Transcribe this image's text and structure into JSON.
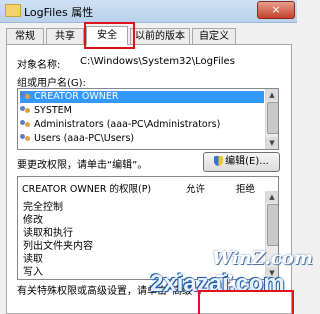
{
  "window": {
    "title": "LogFiles 属性",
    "close_label": "×"
  },
  "tabs": [
    "常规",
    "共享",
    "安全",
    "以前的版本",
    "自定义"
  ],
  "object_name": {
    "label": "对象名称:",
    "value": "C:\\Windows\\System32\\LogFiles"
  },
  "groups": {
    "label": "组或用户名(G):",
    "items": [
      "CREATOR OWNER",
      "SYSTEM",
      "Administrators (aaa-PC\\Administrators)",
      "Users (aaa-PC\\Users)"
    ]
  },
  "change_permissions": {
    "text": "要更改权限，请单击“编辑”。",
    "edit_button": "编辑(E)..."
  },
  "permissions": {
    "header": "CREATOR OWNER 的权限(P)",
    "allow": "允许",
    "deny": "拒绝",
    "rows": [
      "完全控制",
      "修改",
      "读取和执行",
      "列出文件夹内容",
      "读取",
      "写入"
    ]
  },
  "footer": {
    "text": "有关特殊权限或高级设置，请单击“高级”。"
  },
  "watermark": {
    "line1": "WinZ.com家",
    "line2": "2xiazai.com"
  }
}
